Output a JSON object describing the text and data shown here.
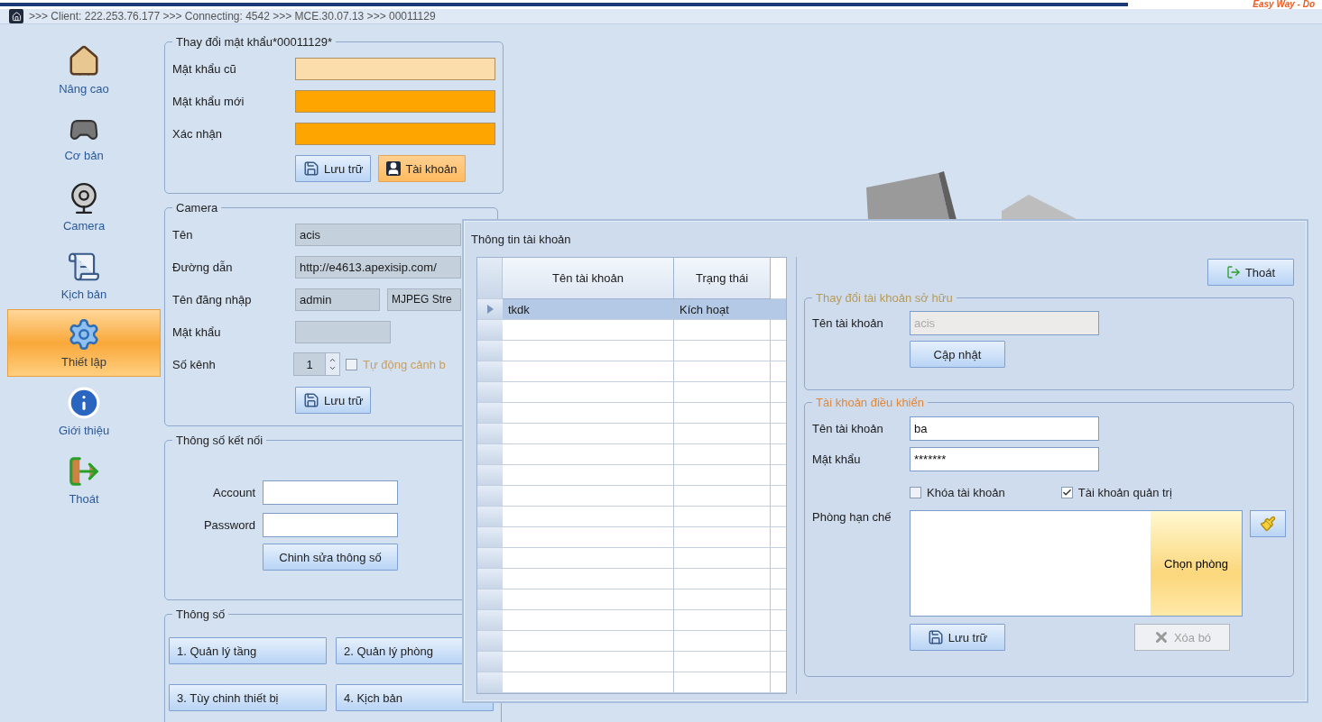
{
  "brand": "Easy Way - Do",
  "breadcrumb": ">>> Client: 222.253.76.177 >>> Connecting: 4542 >>> MCE.30.07.13 >>> 00011129",
  "sidebar": {
    "items": [
      {
        "label": "Nâng cao",
        "kind": "house",
        "selected": false
      },
      {
        "label": "Cơ bản",
        "kind": "gamepad",
        "selected": false
      },
      {
        "label": "Camera",
        "kind": "webcam",
        "selected": false
      },
      {
        "label": "Kịch bản",
        "kind": "scroll",
        "selected": false
      },
      {
        "label": "Thiết lập",
        "kind": "gear",
        "selected": true
      },
      {
        "label": "Giới thiệu",
        "kind": "info",
        "selected": false
      },
      {
        "label": "Thoát",
        "kind": "exit",
        "selected": false
      }
    ]
  },
  "password_panel": {
    "title": "Thay đổi mật khẩu*00011129*",
    "fields": [
      {
        "label": "Mật khẩu cũ",
        "highlighted": false
      },
      {
        "label": "Mật khẩu mới",
        "highlighted": true
      },
      {
        "label": "Xác nhận",
        "highlighted": true
      }
    ],
    "buttons": [
      {
        "label": "Lưu trữ",
        "kind": "save",
        "active": false
      },
      {
        "label": "Tài khoản",
        "kind": "account",
        "active": true
      }
    ]
  },
  "camera": {
    "title": "Camera",
    "name": {
      "label": "Tên",
      "value": "acis"
    },
    "url": {
      "label": "Đường dẫn",
      "value": "http://e4613.apexisip.com/"
    },
    "login": {
      "label": "Tên đăng nhập",
      "value": "admin",
      "stream": "MJPEG Stre"
    },
    "password": {
      "label": "Mật khẩu"
    },
    "channels": {
      "label": "Số kênh",
      "value": "1"
    },
    "auto_alert": {
      "label": "Tự động cảnh b",
      "checked": false
    },
    "save": "Lưu trữ"
  },
  "connection": {
    "title": "Thông số kết nối",
    "account": "Account",
    "password": "Password",
    "button": "Chinh sửa thông số"
  },
  "params": {
    "title": "Thông số",
    "buttons": [
      "1. Quản lý tầng",
      "2. Quản lý phòng",
      "3. Tùy chinh thiết bị",
      "4. Kịch bản"
    ]
  },
  "dialog": {
    "title": "Thông tin tài khoản",
    "table": {
      "columns": [
        "Tên tài khoản",
        "Trạng thái"
      ],
      "rows": [
        {
          "cells": [
            "tkdk",
            "Kích hoạt"
          ],
          "selected": true
        }
      ]
    },
    "exit": "Thoát",
    "owner": {
      "title": "Thay đổi tài khoản sở hữu",
      "label": "Tên tài khoản",
      "value": "acis",
      "disabled": true,
      "button": "Cập nhật"
    },
    "control": {
      "title": "Tài khoản điều khiển",
      "username": {
        "label": "Tên tài khoản",
        "value": "ba"
      },
      "password": {
        "label": "Mật khẩu",
        "value": "*******"
      },
      "lock": {
        "label": "Khóa tài khoản",
        "checked": false
      },
      "admin": {
        "label": "Tài khoản quản trị",
        "checked": true
      },
      "rooms": "Phòng hạn chế",
      "choose": "Chọn phòng",
      "save": "Lưu trữ",
      "delete": {
        "label": "Xóa bó",
        "disabled": true
      }
    }
  }
}
